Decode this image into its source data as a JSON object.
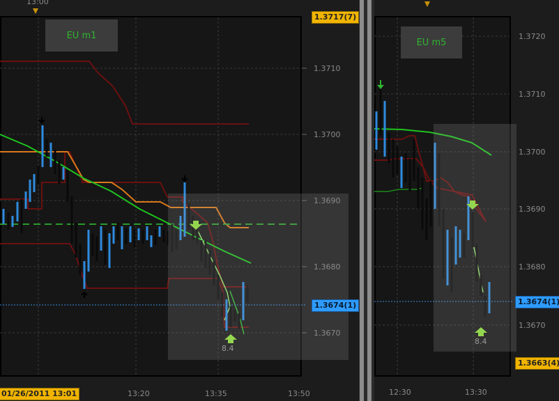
{
  "left_chart": {
    "tag": "EU m1",
    "top_time": "13:00",
    "price_labels": [
      "1.3710",
      "1.3700",
      "1.3690",
      "1.3680",
      "1.3670"
    ],
    "time_labels": [
      "13:20",
      "13:35",
      "13:50"
    ],
    "date_badge": "01/26/2011 13:01",
    "high_badge": "1.3717(7)",
    "current_badge": "1.3674(1)",
    "signal_value": "8.4"
  },
  "right_chart": {
    "tag": "EU m5",
    "price_labels": [
      "1.3720",
      "1.3710",
      "1.3700",
      "1.3690",
      "1.3680",
      "1.3670"
    ],
    "time_labels": [
      "12:30",
      "13:30"
    ],
    "current_badge": "1.3674(1)",
    "low_badge": "1.3663(4)",
    "signal_value": "8.4"
  },
  "colors": {
    "bull_bar": "#2e8bdf",
    "bear_bar": "#0a0a0a",
    "ma_green": "#1ec31e",
    "dark_red": "#7a1212",
    "orange": "#d9781a",
    "accent": "#f0b400"
  }
}
